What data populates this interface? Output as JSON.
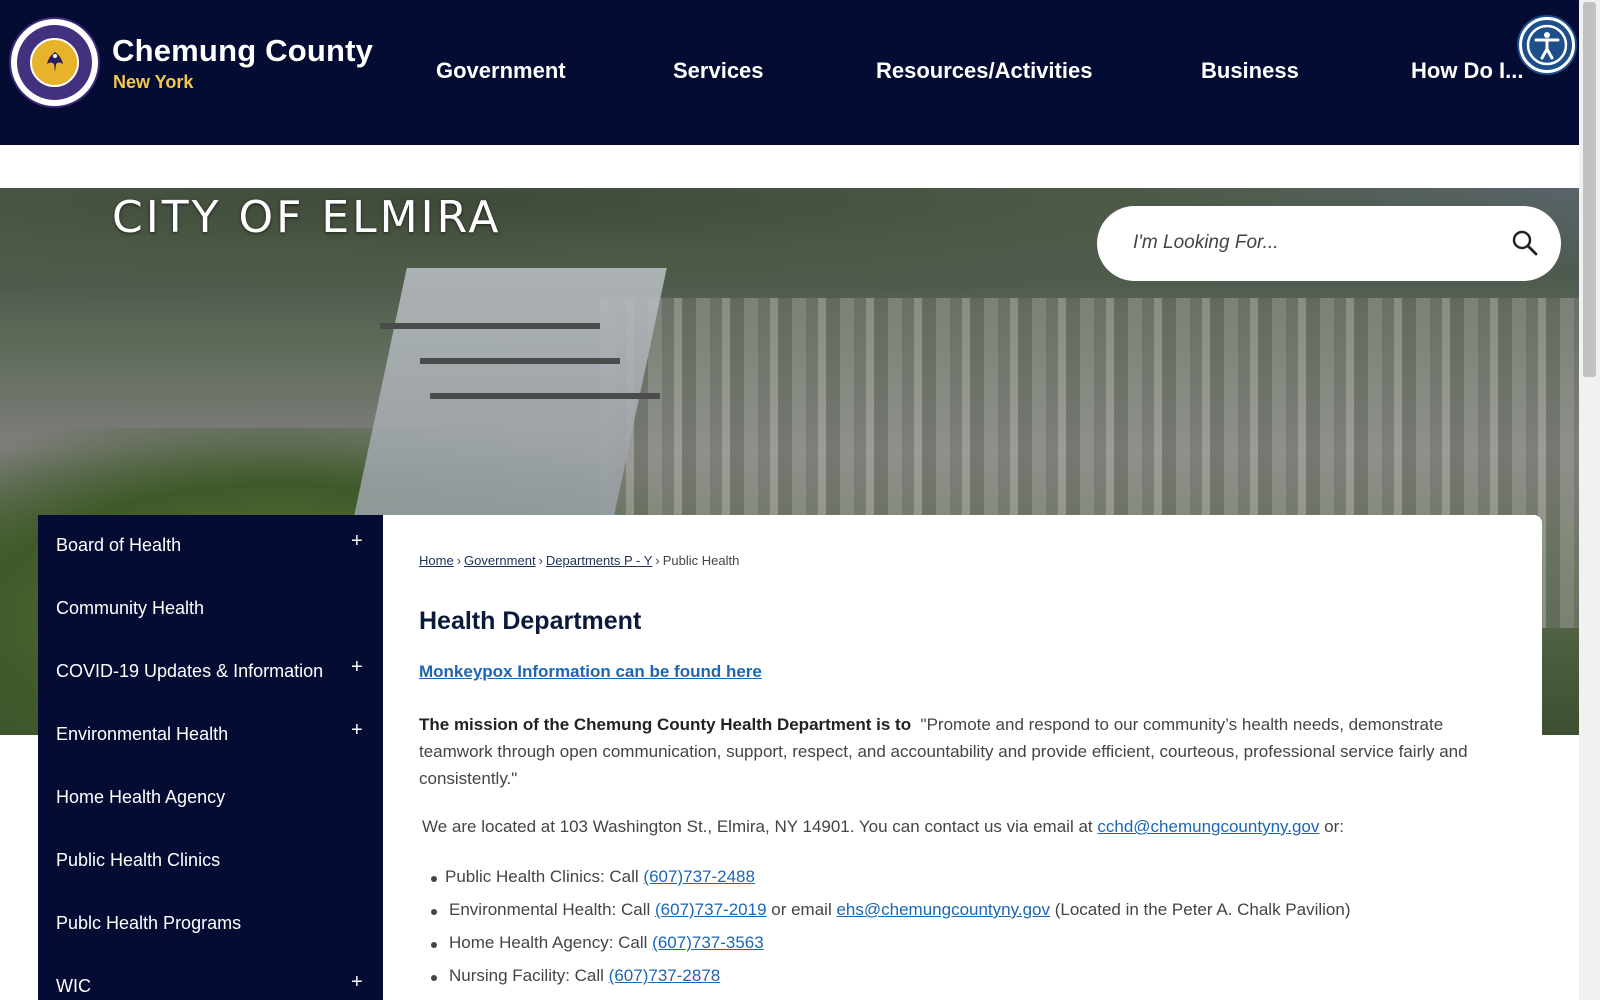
{
  "header": {
    "title": "Chemung County",
    "subtitle": "New York",
    "nav": [
      "Government",
      "Services",
      "Resources/Activities",
      "Business",
      "How Do I..."
    ]
  },
  "hero": {
    "title": "CITY OF ELMIRA"
  },
  "search": {
    "placeholder": "I'm Looking For..."
  },
  "sidebar": {
    "items": [
      {
        "label": "Board of Health",
        "expand": "+"
      },
      {
        "label": "Community Health",
        "expand": ""
      },
      {
        "label": "COVID-19 Updates & Information",
        "expand": "+"
      },
      {
        "label": "Environmental Health",
        "expand": "+"
      },
      {
        "label": "Home Health Agency",
        "expand": ""
      },
      {
        "label": "Public Health Clinics",
        "expand": ""
      },
      {
        "label": "Publc Health Programs",
        "expand": ""
      },
      {
        "label": "WIC",
        "expand": "+"
      }
    ]
  },
  "breadcrumb": {
    "home": "Home",
    "government": "Government",
    "departments": "Departments P - Y",
    "current": "Public Health",
    "sep": "›"
  },
  "main": {
    "title": "Health Department",
    "monkeypox_link": "Monkeypox Information can be found here",
    "mission_bold": "The mission of the Chemung County Health Department is to",
    "mission_text": "\"Promote and respond to our community’s health needs, demonstrate teamwork through open communication, support, respect, and accountability and provide efficient, courteous, professional service fairly and consistently.\"",
    "location_text": "We are located at 103 Washington St., Elmira, NY 14901.  You can contact us via email at",
    "location_email": "cchd@chemungcountyny.gov",
    "location_suffix": "or:",
    "contacts": [
      {
        "text": "Public Health Clinics:  Call",
        "phone": "(607)737-2488"
      },
      {
        "text": "Environmental Health:  Call",
        "phone": "(607)737-2019",
        "mid": "or email",
        "email": "ehs@chemungcountyny.gov",
        "suffix": "(Located in the Peter A. Chalk Pavilion)"
      },
      {
        "text": "Home Health Agency: Call",
        "phone": "(607)737-3563"
      },
      {
        "text": "Nursing Facility: Call",
        "phone": "(607)737-2878"
      }
    ]
  },
  "colors": {
    "navy": "#050c33",
    "link": "#1b67b5",
    "gold": "#f2c94c"
  },
  "icons": {
    "accessibility": "accessibility-icon",
    "search": "search-icon",
    "seal": "county-seal"
  }
}
